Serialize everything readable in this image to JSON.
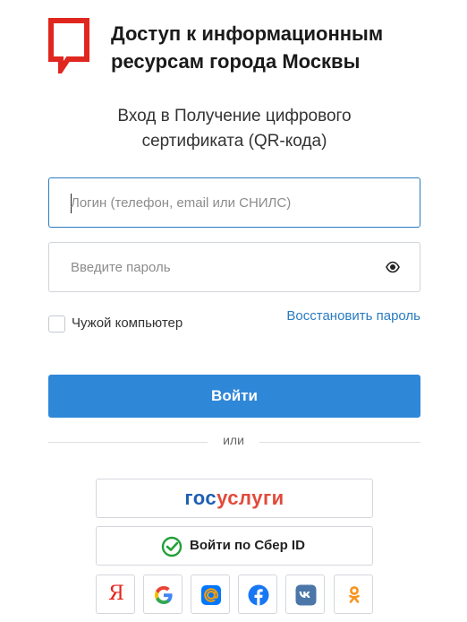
{
  "header": {
    "title_line1": "Доступ к информационным",
    "title_line2": "ресурсам города Москвы"
  },
  "subtitle": {
    "line1": "Вход в Получение цифрового",
    "line2": "сертификата (QR-кода)"
  },
  "login_field": {
    "placeholder": "Логин (телефон, email или СНИЛС)"
  },
  "password_field": {
    "placeholder": "Введите пароль"
  },
  "remember": {
    "label": "Чужой компьютер"
  },
  "restore_link": "Восстановить пароль",
  "login_button": "Войти",
  "divider": "или",
  "gosuslugi": {
    "part1": "гос",
    "part2": "услуги"
  },
  "sber_button": "Войти по Сбер ID",
  "social": {
    "yandex_glyph": "Я"
  },
  "colors": {
    "accent": "#2f87d8",
    "link": "#2a7bc2",
    "logo_red": "#e0271f",
    "gos_blue": "#1d5fb4",
    "gos_red": "#e24a3b"
  }
}
